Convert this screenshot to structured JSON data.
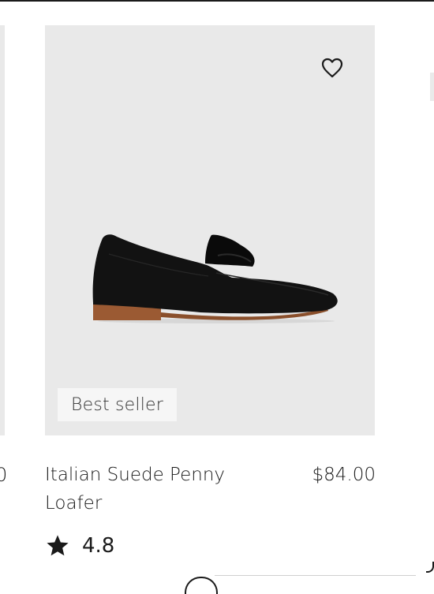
{
  "product": {
    "name": "Italian Suede Penny Loafer",
    "price": "$84.00",
    "badge": "Best seller",
    "rating": "4.8",
    "wishlist_icon": "heart-outline-icon",
    "rating_icon": "star-icon"
  },
  "previous_card": {
    "price_fragment": "0"
  },
  "colors": {
    "image_background": "#e9e9e9",
    "badge_background": "#f6f6f6",
    "text": "#1a1a1a"
  }
}
